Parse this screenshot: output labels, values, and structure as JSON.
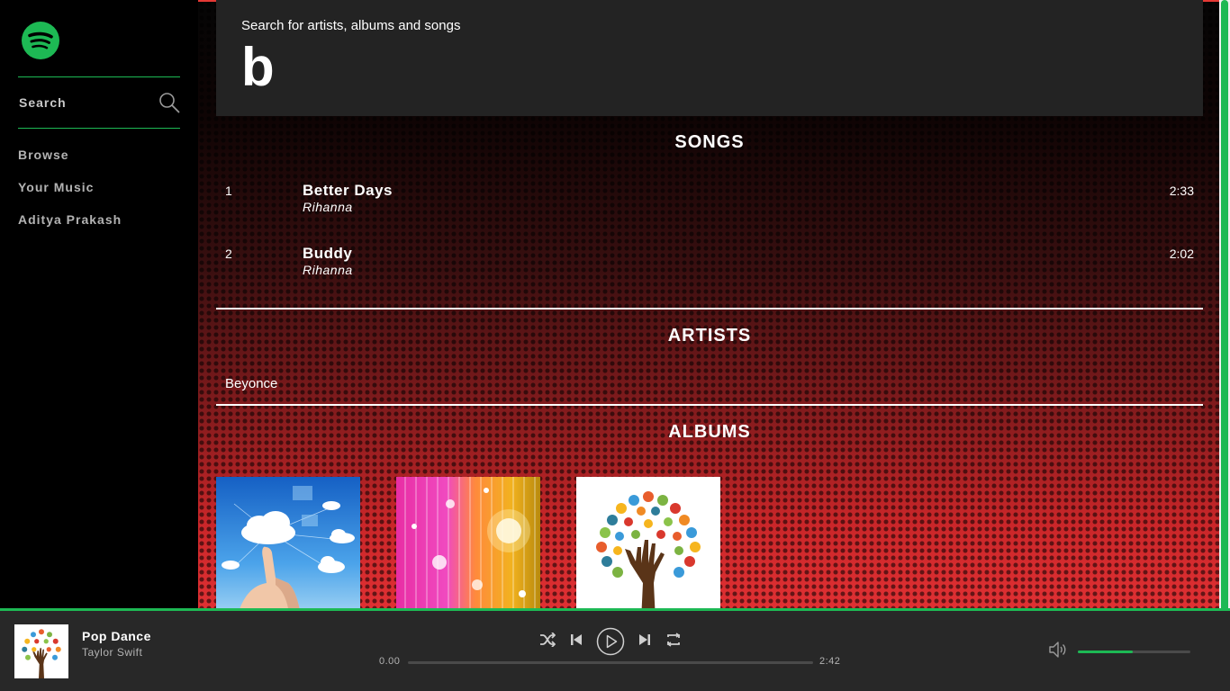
{
  "sidebar": {
    "logo_icon": "spotify-logo",
    "search_label": "Search",
    "search_icon": "search-icon",
    "items": [
      {
        "label": "Browse"
      },
      {
        "label": "Your Music"
      },
      {
        "label": "Aditya Prakash"
      }
    ],
    "accent_color": "#1db954"
  },
  "search": {
    "hint": "Search for artists, albums and songs",
    "query": "b"
  },
  "results": {
    "songs_title": "SONGS",
    "songs": [
      {
        "number": "1",
        "title": "Better Days",
        "artist": "Rihanna",
        "duration": "2:33"
      },
      {
        "number": "2",
        "title": "Buddy",
        "artist": "Rihanna",
        "duration": "2:02"
      }
    ],
    "artists_title": "ARTISTS",
    "artists": [
      "Beyonce"
    ],
    "albums_title": "ALBUMS",
    "albums": [
      {
        "art": "cloud-touch-art"
      },
      {
        "art": "sparkle-lights-art"
      },
      {
        "art": "handprint-tree-art"
      }
    ]
  },
  "player": {
    "track_title": "Pop Dance",
    "track_artist": "Taylor Swift",
    "art": "handprint-tree-art",
    "elapsed": "0.00",
    "total": "2:42",
    "progress_fraction": 0,
    "volume_fraction": 0.49,
    "controls": [
      "shuffle-icon",
      "previous-icon",
      "play-icon",
      "next-icon",
      "repeat-icon"
    ],
    "volume_icon": "volume-icon"
  }
}
